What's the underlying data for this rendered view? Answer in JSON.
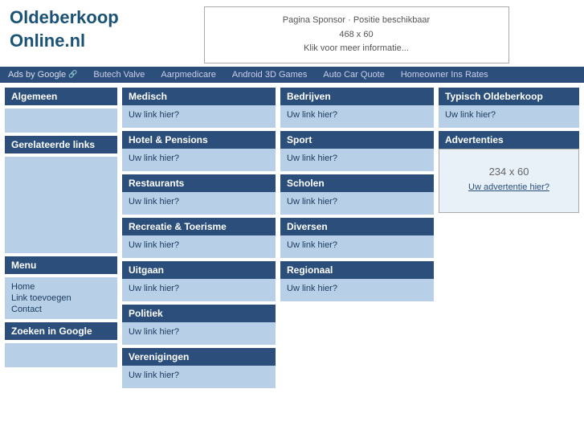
{
  "logo": {
    "line1_o": "O",
    "line1_text": "ldeberkoop",
    "line2_o": "O",
    "line2_text": "nline.nl"
  },
  "sponsor": {
    "line1": "Pagina Sponsor · Positie beschikbaar",
    "line2": "468 x 60",
    "line3": "Klik voor meer informatie..."
  },
  "ads_bar": {
    "ads_google": "Ads by Google",
    "links": [
      "Butech Valve",
      "Aarpmedicare",
      "Android 3D Games",
      "Auto Car Quote",
      "Homeowner Ins Rates"
    ]
  },
  "sidebar": {
    "algemeen_label": "Algemeen",
    "gerelateerde_label": "Gerelateerde links",
    "menu_label": "Menu",
    "menu_items": [
      "Home",
      "Link toevoegen",
      "Contact"
    ],
    "zoeken_label": "Zoeken in Google"
  },
  "categories": {
    "medisch": {
      "header": "Medisch",
      "link": "Uw link hier?"
    },
    "bedrijven": {
      "header": "Bedrijven",
      "link": "Uw link hier?"
    },
    "typisch": {
      "header": "Typisch Oldeberkoop",
      "link": "Uw link hier?"
    },
    "hotel": {
      "header": "Hotel & Pensions",
      "link": "Uw link hier?"
    },
    "sport": {
      "header": "Sport",
      "link": "Uw link hier?"
    },
    "advertenties": {
      "header": "Advertenties",
      "ad_size": "234 x 60",
      "ad_link": "Uw advertentie hier?"
    },
    "restaurants": {
      "header": "Restaurants",
      "link": "Uw link hier?"
    },
    "scholen": {
      "header": "Scholen",
      "link": "Uw link hier?"
    },
    "recreatie": {
      "header": "Recreatie & Toerisme",
      "link": "Uw link hier?"
    },
    "diversen": {
      "header": "Diversen",
      "link": "Uw link hier?"
    },
    "uitgaan": {
      "header": "Uitgaan",
      "link": "Uw link hier?"
    },
    "regionaal": {
      "header": "Regionaal",
      "link": "Uw link hier?"
    },
    "politiek": {
      "header": "Politiek",
      "link": "Uw link hier?"
    },
    "verenigingen": {
      "header": "Verenigingen",
      "link": "Uw link hier?"
    }
  }
}
